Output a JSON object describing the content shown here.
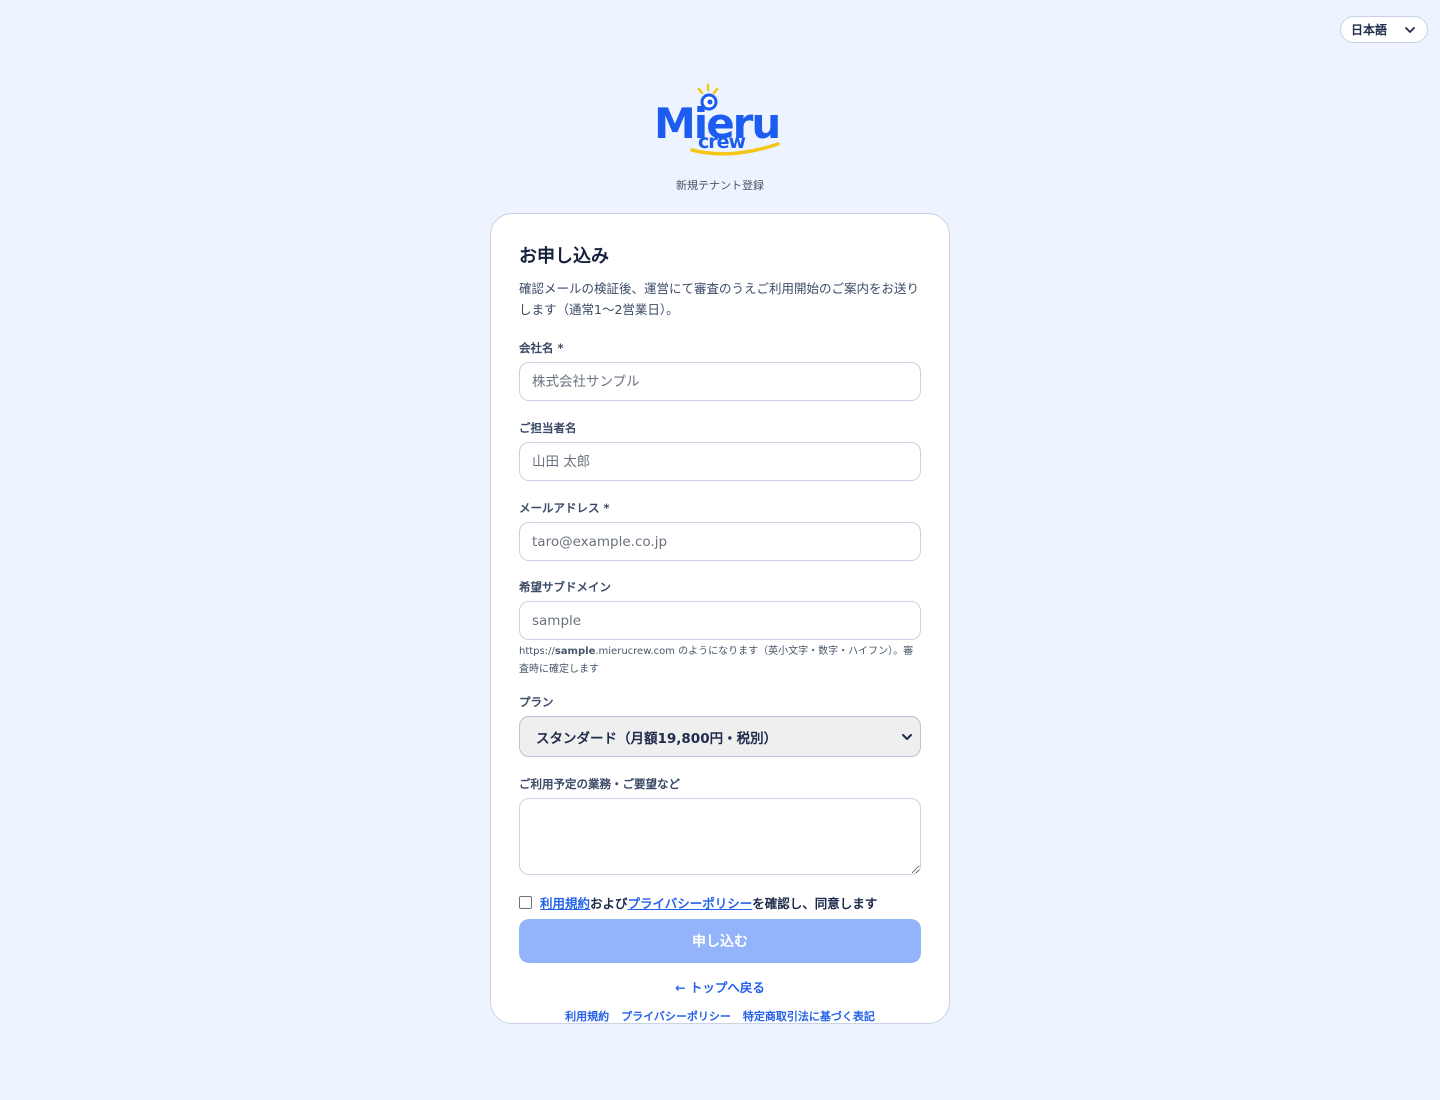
{
  "language": {
    "selected": "日本語"
  },
  "brand": {
    "logo_line1": "Mieru",
    "logo_line2": "crew",
    "subtitle": "新規テナント登録"
  },
  "form": {
    "title": "お申し込み",
    "description": "確認メールの検証後、運営にて審査のうえご利用開始のご案内をお送りします（通常1〜2営業日）。",
    "company": {
      "label": "会社名 *",
      "placeholder": "株式会社サンプル",
      "value": ""
    },
    "contact": {
      "label": "ご担当者名",
      "placeholder": "山田 太郎",
      "value": ""
    },
    "email": {
      "label": "メールアドレス *",
      "placeholder": "taro@example.co.jp",
      "value": ""
    },
    "subdomain": {
      "label": "希望サブドメイン",
      "placeholder": "sample",
      "value": "",
      "hint_prefix": "https://",
      "hint_bold": "sample",
      "hint_suffix": ".mierucrew.com のようになります（英小文字・数字・ハイフン）。審査時に確定します"
    },
    "plan": {
      "label": "プラン",
      "selected": "スタンダード（月額19,800円・税別）"
    },
    "notes": {
      "label": "ご利用予定の業務・ご要望など",
      "value": ""
    },
    "agree": {
      "checked": false,
      "terms_link": "利用規約",
      "middle": "および",
      "privacy_link": "プライバシーポリシー",
      "suffix": "を確認し、同意します"
    },
    "submit_label": "申し込む",
    "back_label": "← トップへ戻る"
  },
  "footer": {
    "links": [
      "利用規約",
      "プライバシーポリシー",
      "特定商取引法に基づく表記"
    ]
  },
  "colors": {
    "page_bg": "#eef4ff",
    "accent": "#2563eb",
    "submit_disabled": "#93b4fb",
    "logo_blue": "#1d5cf0",
    "logo_yellow": "#f5c518"
  }
}
